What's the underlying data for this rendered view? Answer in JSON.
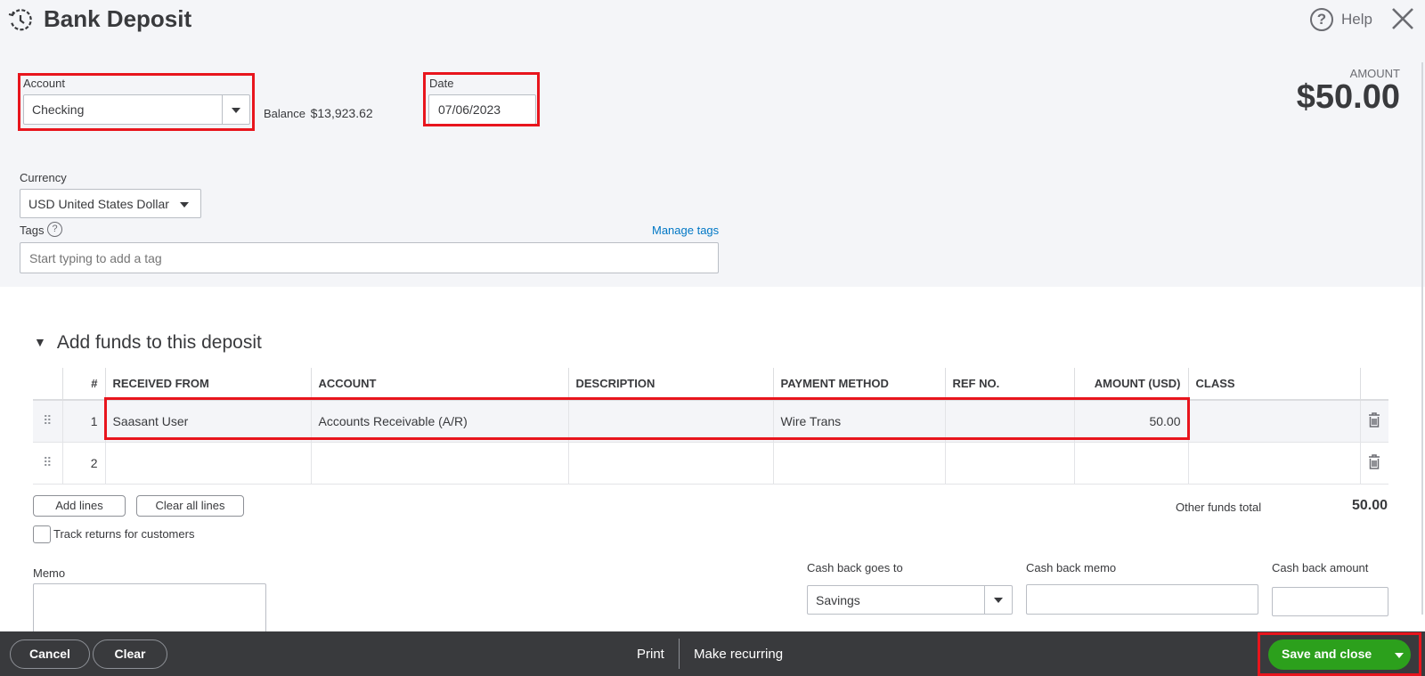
{
  "header": {
    "title": "Bank Deposit",
    "help_label": "Help"
  },
  "account": {
    "label": "Account",
    "value": "Checking",
    "balance_label": "Balance",
    "balance_value": "$13,923.62"
  },
  "date": {
    "label": "Date",
    "value": "07/06/2023"
  },
  "amount": {
    "label": "AMOUNT",
    "value": "$50.00"
  },
  "currency": {
    "label": "Currency",
    "value": "USD United States Dollar"
  },
  "tags": {
    "label": "Tags",
    "help_icon": "?",
    "manage_link": "Manage tags",
    "placeholder": "Start typing to add a tag"
  },
  "funds_section": {
    "title": "Add funds to this deposit",
    "columns": [
      "#",
      "RECEIVED FROM",
      "ACCOUNT",
      "DESCRIPTION",
      "PAYMENT METHOD",
      "REF NO.",
      "AMOUNT (USD)",
      "CLASS"
    ],
    "rows": [
      {
        "num": "1",
        "received_from": "Saasant User",
        "account": "Accounts Receivable (A/R)",
        "description": "",
        "payment_method": "Wire Trans",
        "ref_no": "",
        "amount": "50.00",
        "class": ""
      },
      {
        "num": "2",
        "received_from": "",
        "account": "",
        "description": "",
        "payment_method": "",
        "ref_no": "",
        "amount": "",
        "class": ""
      }
    ],
    "add_lines": "Add lines",
    "clear_all_lines": "Clear all lines",
    "track_returns": "Track returns for customers",
    "other_funds_label": "Other funds total",
    "other_funds_value": "50.00"
  },
  "memo": {
    "label": "Memo"
  },
  "cash_back": {
    "goes_to_label": "Cash back goes to",
    "goes_to_value": "Savings",
    "memo_label": "Cash back memo",
    "amount_label": "Cash back amount"
  },
  "footer": {
    "cancel": "Cancel",
    "clear": "Clear",
    "print": "Print",
    "make_recurring": "Make recurring",
    "save_and_close": "Save and close"
  },
  "colors": {
    "accent_green": "#2ca01c",
    "link_blue": "#0077c5",
    "highlight_red": "#e8151d",
    "footer_bg": "#393a3d"
  }
}
